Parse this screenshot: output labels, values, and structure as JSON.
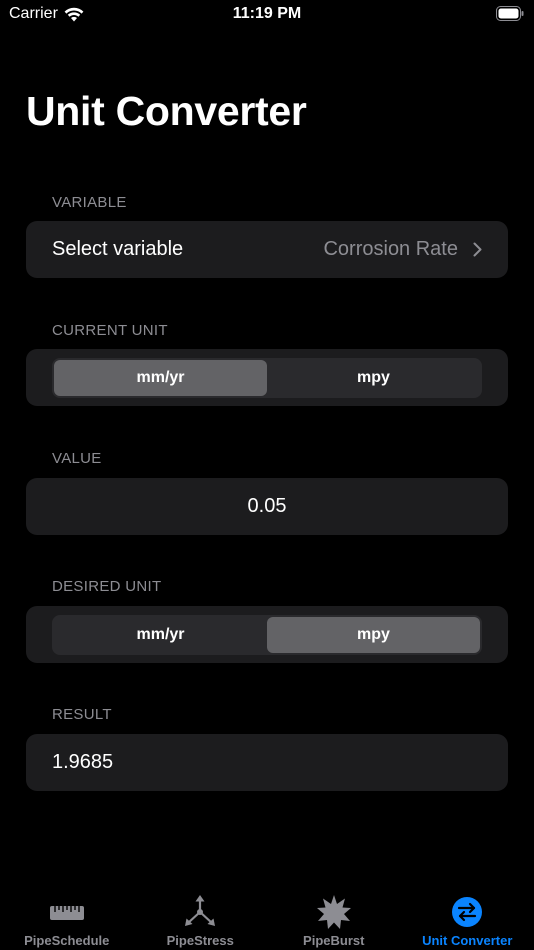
{
  "status_bar": {
    "carrier": "Carrier",
    "time": "11:19 PM",
    "wifi_icon": "wifi-icon",
    "battery_icon": "battery-icon"
  },
  "title": "Unit Converter",
  "variable": {
    "header": "VARIABLE",
    "label": "Select variable",
    "value": "Corrosion Rate",
    "chevron_icon": "chevron-right-icon"
  },
  "current_unit": {
    "header": "CURRENT UNIT",
    "options": [
      "mm/yr",
      "mpy"
    ],
    "selected": "mm/yr"
  },
  "value": {
    "header": "VALUE",
    "text": "0.05"
  },
  "desired_unit": {
    "header": "DESIRED UNIT",
    "options": [
      "mm/yr",
      "mpy"
    ],
    "selected": "mpy"
  },
  "result": {
    "header": "RESULT",
    "text": "1.9685"
  },
  "tabs": [
    {
      "label": "PipeSchedule",
      "icon": "ruler-icon",
      "active": false
    },
    {
      "label": "PipeStress",
      "icon": "arrows-triangle-icon",
      "active": false
    },
    {
      "label": "PipeBurst",
      "icon": "burst-star-icon",
      "active": false
    },
    {
      "label": "Unit Converter",
      "icon": "swap-arrows-icon",
      "active": true
    }
  ],
  "colors": {
    "background": "#000000",
    "card": "#1c1c1e",
    "secondary_text": "#8d8d93",
    "segment_selected": "#636366",
    "accent": "#0a84ff"
  }
}
